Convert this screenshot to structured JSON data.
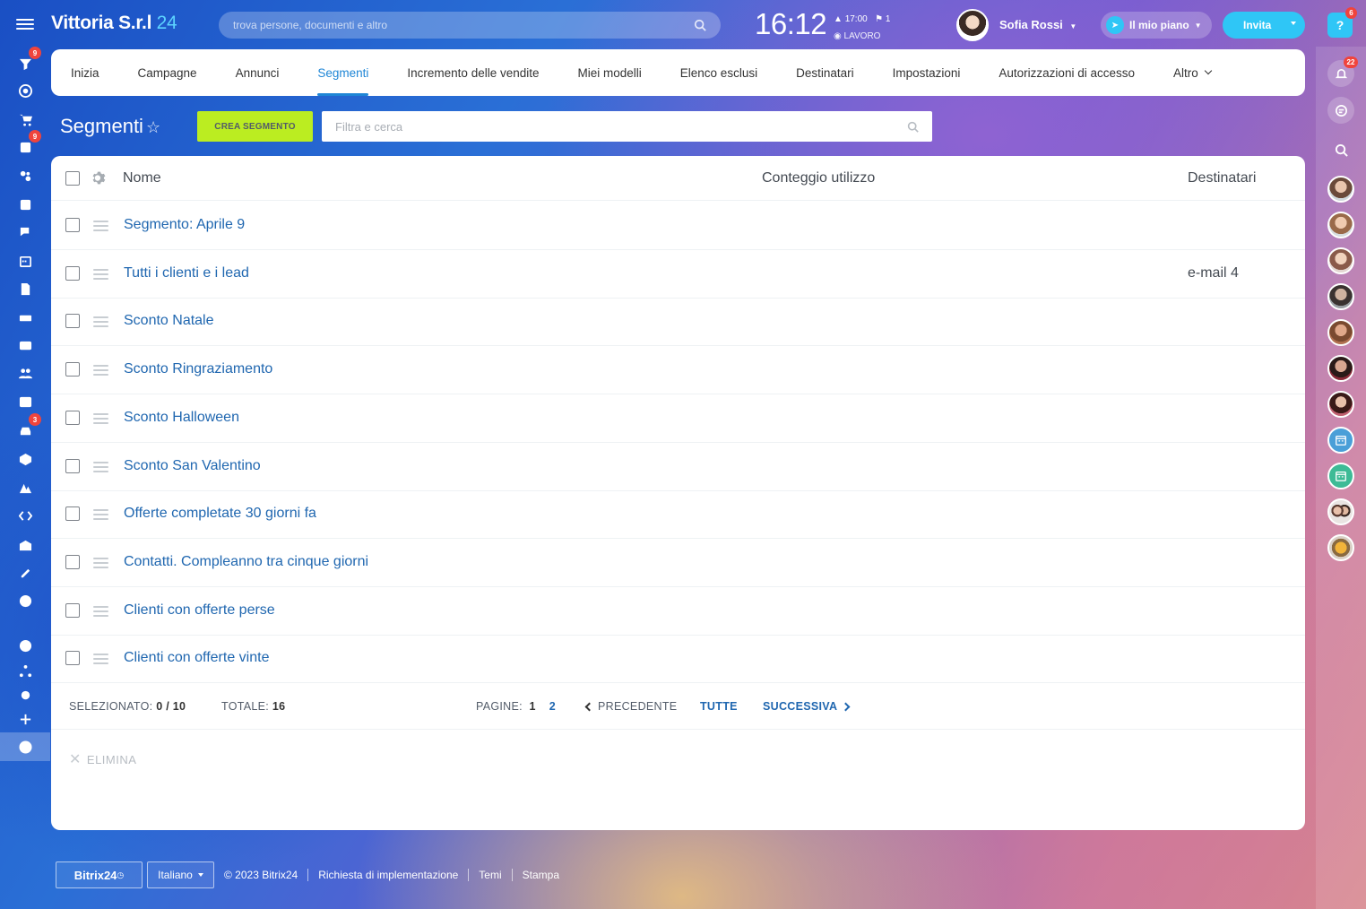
{
  "header": {
    "brand_name": "Vittoria S.r.l",
    "brand_number": "24",
    "search_placeholder": "trova persone, documenti e altro",
    "clock": "16:12",
    "clock_alarm": "17:00",
    "clock_flag_count": "1",
    "work_status": "LAVORO",
    "user_name": "Sofia Rossi",
    "plan_label": "Il mio piano",
    "invite_label": "Invita",
    "help_label": "?",
    "help_badge": "6"
  },
  "left_sidebar": {
    "badges": {
      "filter": "9",
      "tasks": "9",
      "car": "3"
    }
  },
  "right_sidebar": {
    "notifications_badge": "22"
  },
  "tabs": [
    {
      "label": "Inizia"
    },
    {
      "label": "Campagne"
    },
    {
      "label": "Annunci"
    },
    {
      "label": "Segmenti",
      "active": true
    },
    {
      "label": "Incremento delle vendite"
    },
    {
      "label": "Miei modelli"
    },
    {
      "label": "Elenco esclusi"
    },
    {
      "label": "Destinatari"
    },
    {
      "label": "Impostazioni"
    },
    {
      "label": "Autorizzazioni di accesso"
    },
    {
      "label": "Altro"
    }
  ],
  "page": {
    "title": "Segmenti",
    "create_button": "CREA SEGMENTO",
    "filter_placeholder": "Filtra e cerca"
  },
  "table": {
    "columns": {
      "name": "Nome",
      "usage": "Conteggio utilizzo",
      "recipients": "Destinatari"
    },
    "rows": [
      {
        "name": "Segmento: Aprile 9",
        "recipients": ""
      },
      {
        "name": "Tutti i clienti e i lead",
        "recipients": "e-mail 4"
      },
      {
        "name": "Sconto Natale",
        "recipients": ""
      },
      {
        "name": "Sconto Ringraziamento",
        "recipients": ""
      },
      {
        "name": "Sconto Halloween",
        "recipients": ""
      },
      {
        "name": "Sconto San Valentino",
        "recipients": ""
      },
      {
        "name": "Offerte completate 30 giorni fa",
        "recipients": ""
      },
      {
        "name": "Contatti. Compleanno tra cinque giorni",
        "recipients": ""
      },
      {
        "name": "Clienti con offerte perse",
        "recipients": ""
      },
      {
        "name": "Clienti con offerte vinte",
        "recipients": ""
      }
    ],
    "footer": {
      "selected_label": "SELEZIONATO:",
      "selected_value": "0 / 10",
      "total_label": "TOTALE:",
      "total_value": "16",
      "pages_label": "PAGINE:",
      "page_current": "1",
      "page_next": "2",
      "prev_label": "PRECEDENTE",
      "all_label": "TUTTE",
      "next_label": "SUCCESSIVA"
    },
    "delete_label": "ELIMINA"
  },
  "bottom": {
    "b24_label": "Bitrix24",
    "language": "Italiano",
    "copyright": "© 2023 Bitrix24",
    "link_impl": "Richiesta di implementazione",
    "link_themes": "Temi",
    "link_print": "Stampa"
  }
}
